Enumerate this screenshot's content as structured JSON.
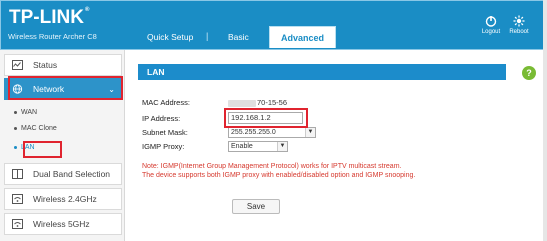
{
  "header": {
    "brand": "TP-LINK",
    "brand_mark": "®",
    "model": "Wireless Router Archer C8",
    "tabs": {
      "quick_setup": "Quick Setup",
      "basic": "Basic",
      "advanced": "Advanced"
    },
    "separator": "|",
    "logout_label": "Logout",
    "reboot_label": "Reboot"
  },
  "sidebar": {
    "status": "Status",
    "network": "Network",
    "network_chevron": "⌄",
    "sub_items": {
      "wan": "WAN",
      "mac_clone": "MAC Clone",
      "lan": "LAN"
    },
    "dual_band": "Dual Band Selection",
    "wireless24": "Wireless 2.4GHz",
    "wireless5": "Wireless 5GHz"
  },
  "main": {
    "section_title": "LAN",
    "help": "?",
    "mac_label": "MAC Address:",
    "mac_value": "70-15-56",
    "ip_label": "IP Address:",
    "ip_value": "192.168.1.2",
    "mask_label": "Subnet Mask:",
    "mask_value": "255.255.255.0",
    "igmp_label": "IGMP Proxy:",
    "igmp_value": "Enable",
    "note_line1": "Note: IGMP(Internet Group Management Protocol) works for IPTV multicast stream.",
    "note_line2": "The device supports both IGMP proxy with enabled/disabled option and IGMP snooping.",
    "save_label": "Save"
  },
  "colors": {
    "header_blue": "#1a8dc5",
    "active_menu": "#2d93c9",
    "note_red": "#d63a2f",
    "highlight_red": "#e0242f",
    "help_green": "#79bb34"
  },
  "icons": [
    "logout-icon",
    "reboot-icon",
    "status-icon",
    "network-icon",
    "dual-band-icon",
    "wireless-icon"
  ]
}
